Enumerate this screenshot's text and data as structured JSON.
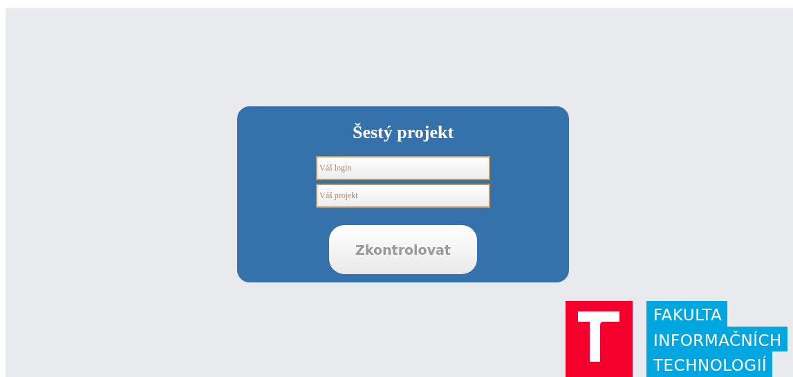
{
  "form": {
    "title": "Šestý projekt",
    "fields": [
      {
        "placeholder": "Váš login"
      },
      {
        "placeholder": "Váš projekt"
      }
    ],
    "button": "Zkontrolovat"
  },
  "logo": {
    "lines": [
      "FAKULTA",
      "INFORMAČNÍCH",
      "TECHNOLOGIÍ"
    ]
  }
}
